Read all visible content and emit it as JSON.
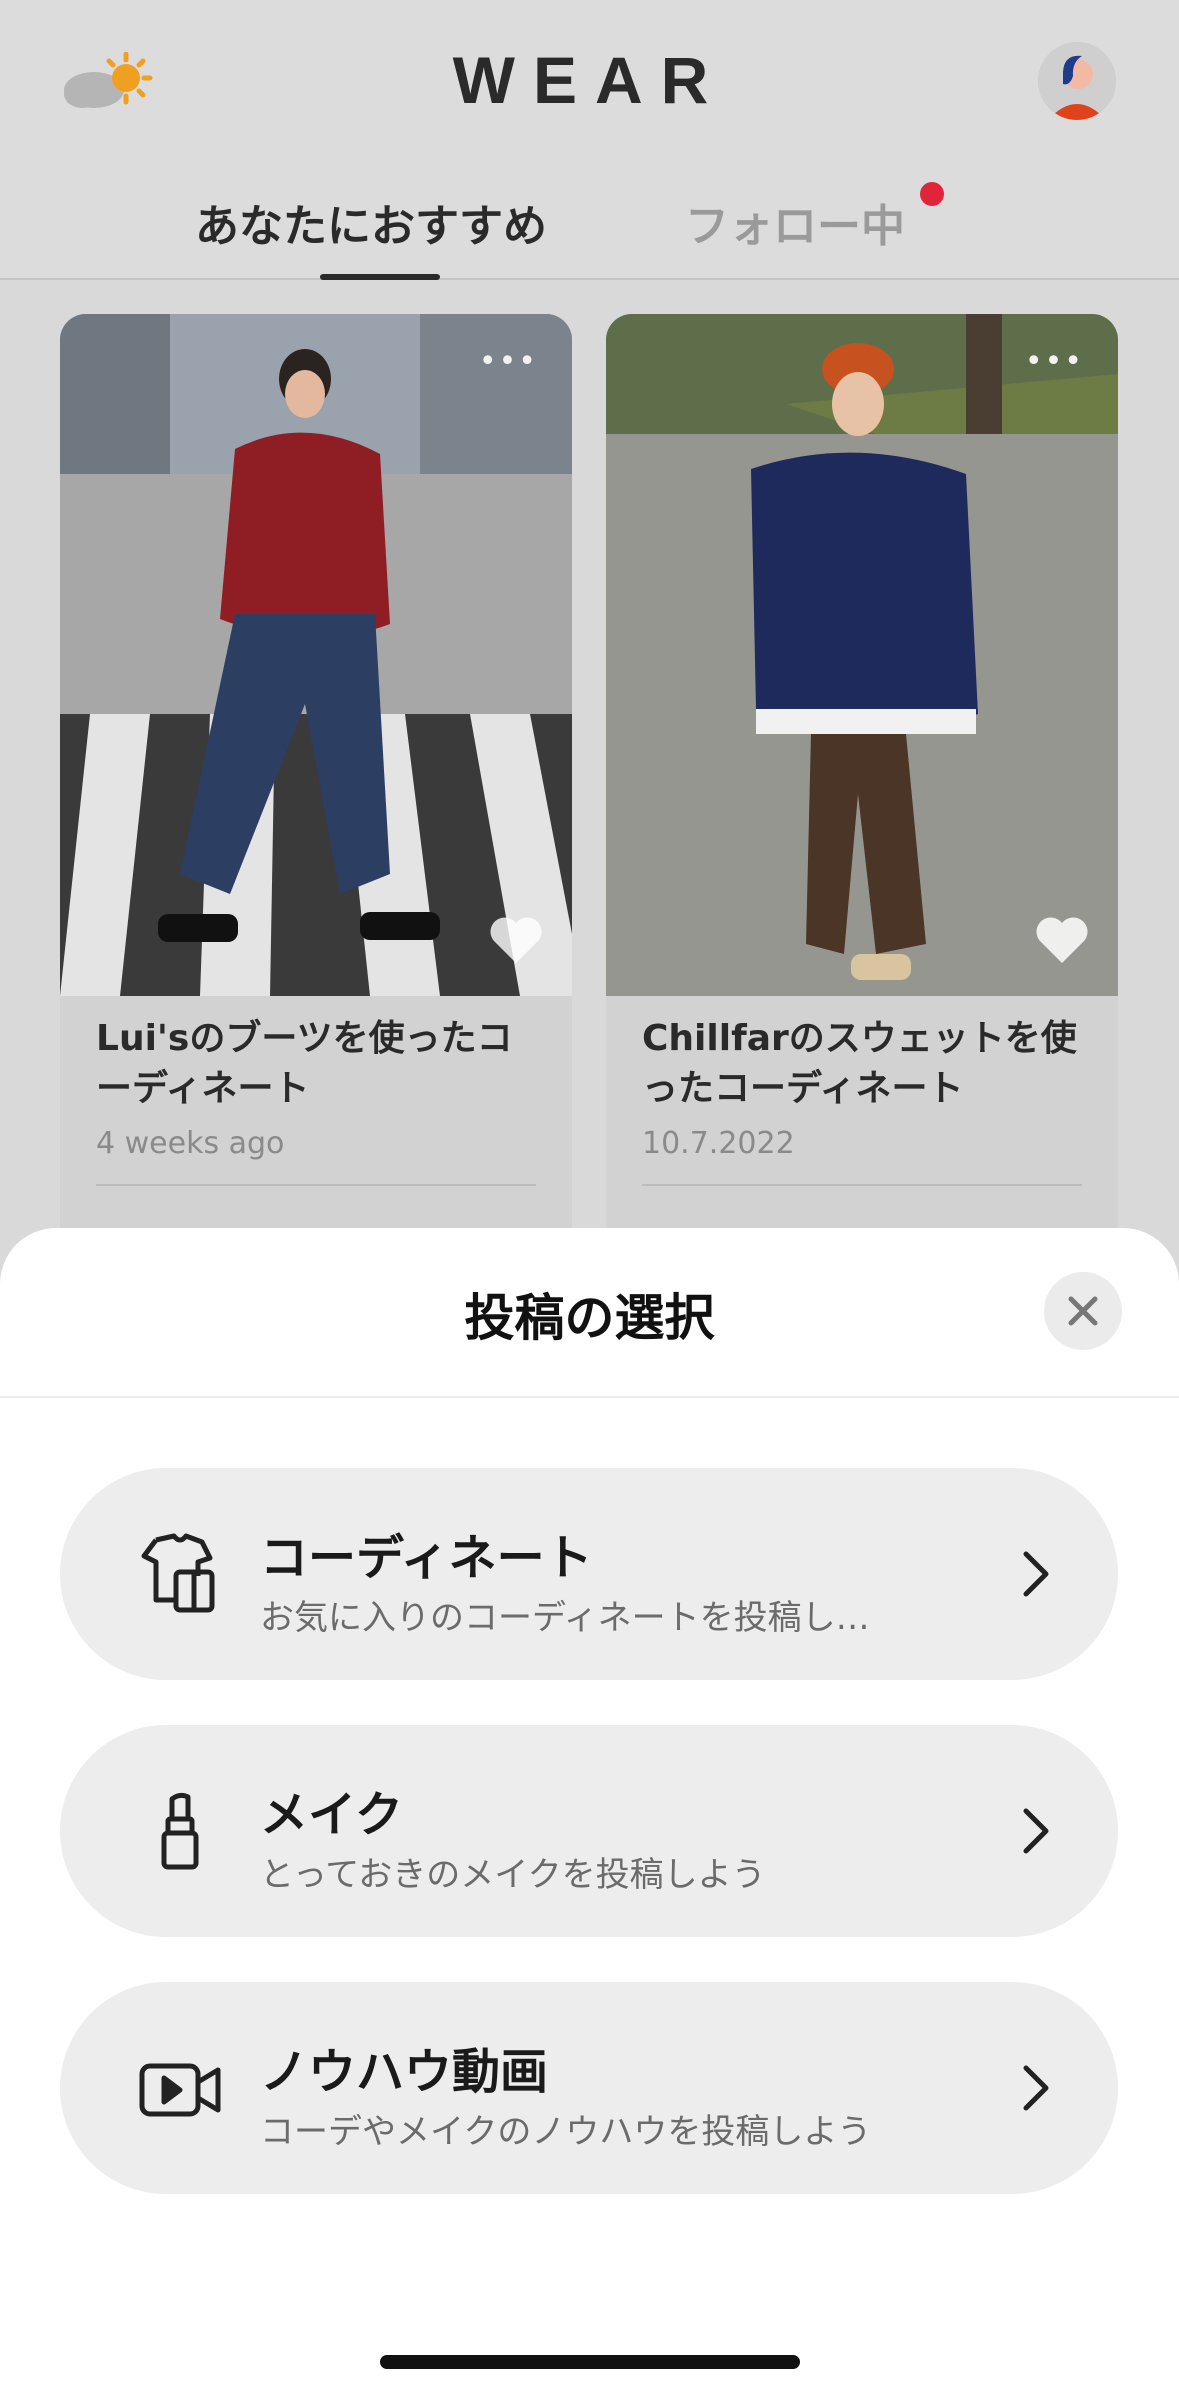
{
  "header": {
    "logo": "WEAR",
    "weather_icon": "partly-sunny-icon",
    "avatar_icon": "user-avatar"
  },
  "tabs": [
    {
      "label": "あなたにおすすめ",
      "active": true
    },
    {
      "label": "フォロー中",
      "active": false,
      "has_notification": true
    }
  ],
  "feed": [
    {
      "title": "Lui'sのブーツを使ったコーディネート",
      "date": "4 weeks ago",
      "more": "•••"
    },
    {
      "title": "Chillfarのスウェットを使ったコーディネート",
      "date": "10.7.2022",
      "more": "•••"
    }
  ],
  "sheet": {
    "title": "投稿の選択",
    "options": [
      {
        "title": "コーディネート",
        "subtitle": "お気に入りのコーディネートを投稿し…",
        "icon": "clothing-icon"
      },
      {
        "title": "メイク",
        "subtitle": "とっておきのメイクを投稿しよう",
        "icon": "lipstick-icon"
      },
      {
        "title": "ノウハウ動画",
        "subtitle": "コーデやメイクのノウハウを投稿しよう",
        "icon": "video-camera-icon"
      }
    ]
  },
  "colors": {
    "accent_dot": "#e0243a",
    "sheet_bg": "#ffffff",
    "option_bg": "#ededed"
  }
}
